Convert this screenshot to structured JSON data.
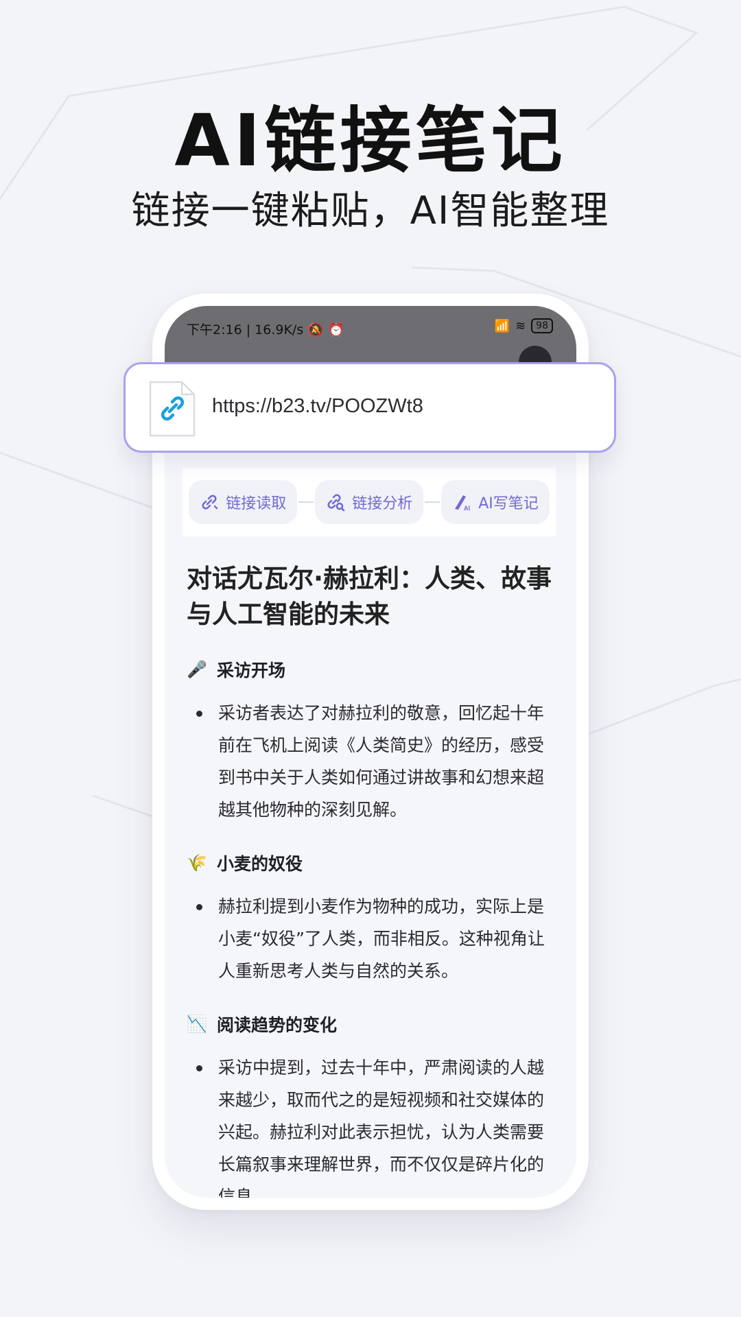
{
  "hero": {
    "title": "AI链接笔记",
    "subtitle": "链接一键粘贴，AI智能整理"
  },
  "status_bar": {
    "time": "下午2:16",
    "speed": "16.9K/s",
    "battery": "98"
  },
  "url_card": {
    "url": "https://b23.tv/POOZWt8",
    "icon": "link-file-icon"
  },
  "actions": [
    {
      "label": "链接读取",
      "icon": "link-read-icon"
    },
    {
      "label": "链接分析",
      "icon": "link-analyze-icon"
    },
    {
      "label": "AI写笔记",
      "icon": "ai-pen-icon"
    }
  ],
  "article": {
    "title": "对话尤瓦尔·赫拉利：人类、故事与人工智能的未来",
    "sections": [
      {
        "emoji": "🎤",
        "heading": "采访开场",
        "bullets": [
          "采访者表达了对赫拉利的敬意，回忆起十年前在飞机上阅读《人类简史》的经历，感受到书中关于人类如何通过讲故事和幻想来超越其他物种的深刻见解。"
        ]
      },
      {
        "emoji": "🌾",
        "heading": "小麦的奴役",
        "bullets": [
          "赫拉利提到小麦作为物种的成功，实际上是小麦“奴役”了人类，而非相反。这种视角让人重新思考人类与自然的关系。"
        ]
      },
      {
        "emoji": "📉",
        "heading": "阅读趋势的变化",
        "bullets": [
          "采访中提到，过去十年中，严肃阅读的人越来越少，取而代之的是短视频和社交媒体的兴起。赫拉利对此表示担忧，认为人类需要长篇叙事来理解世界，而不仅仅是碎片化的信息。"
        ]
      }
    ]
  },
  "colors": {
    "accent": "#6f6ad6",
    "card_border": "#a8a1ec",
    "link_icon": "#1aa0e0"
  }
}
